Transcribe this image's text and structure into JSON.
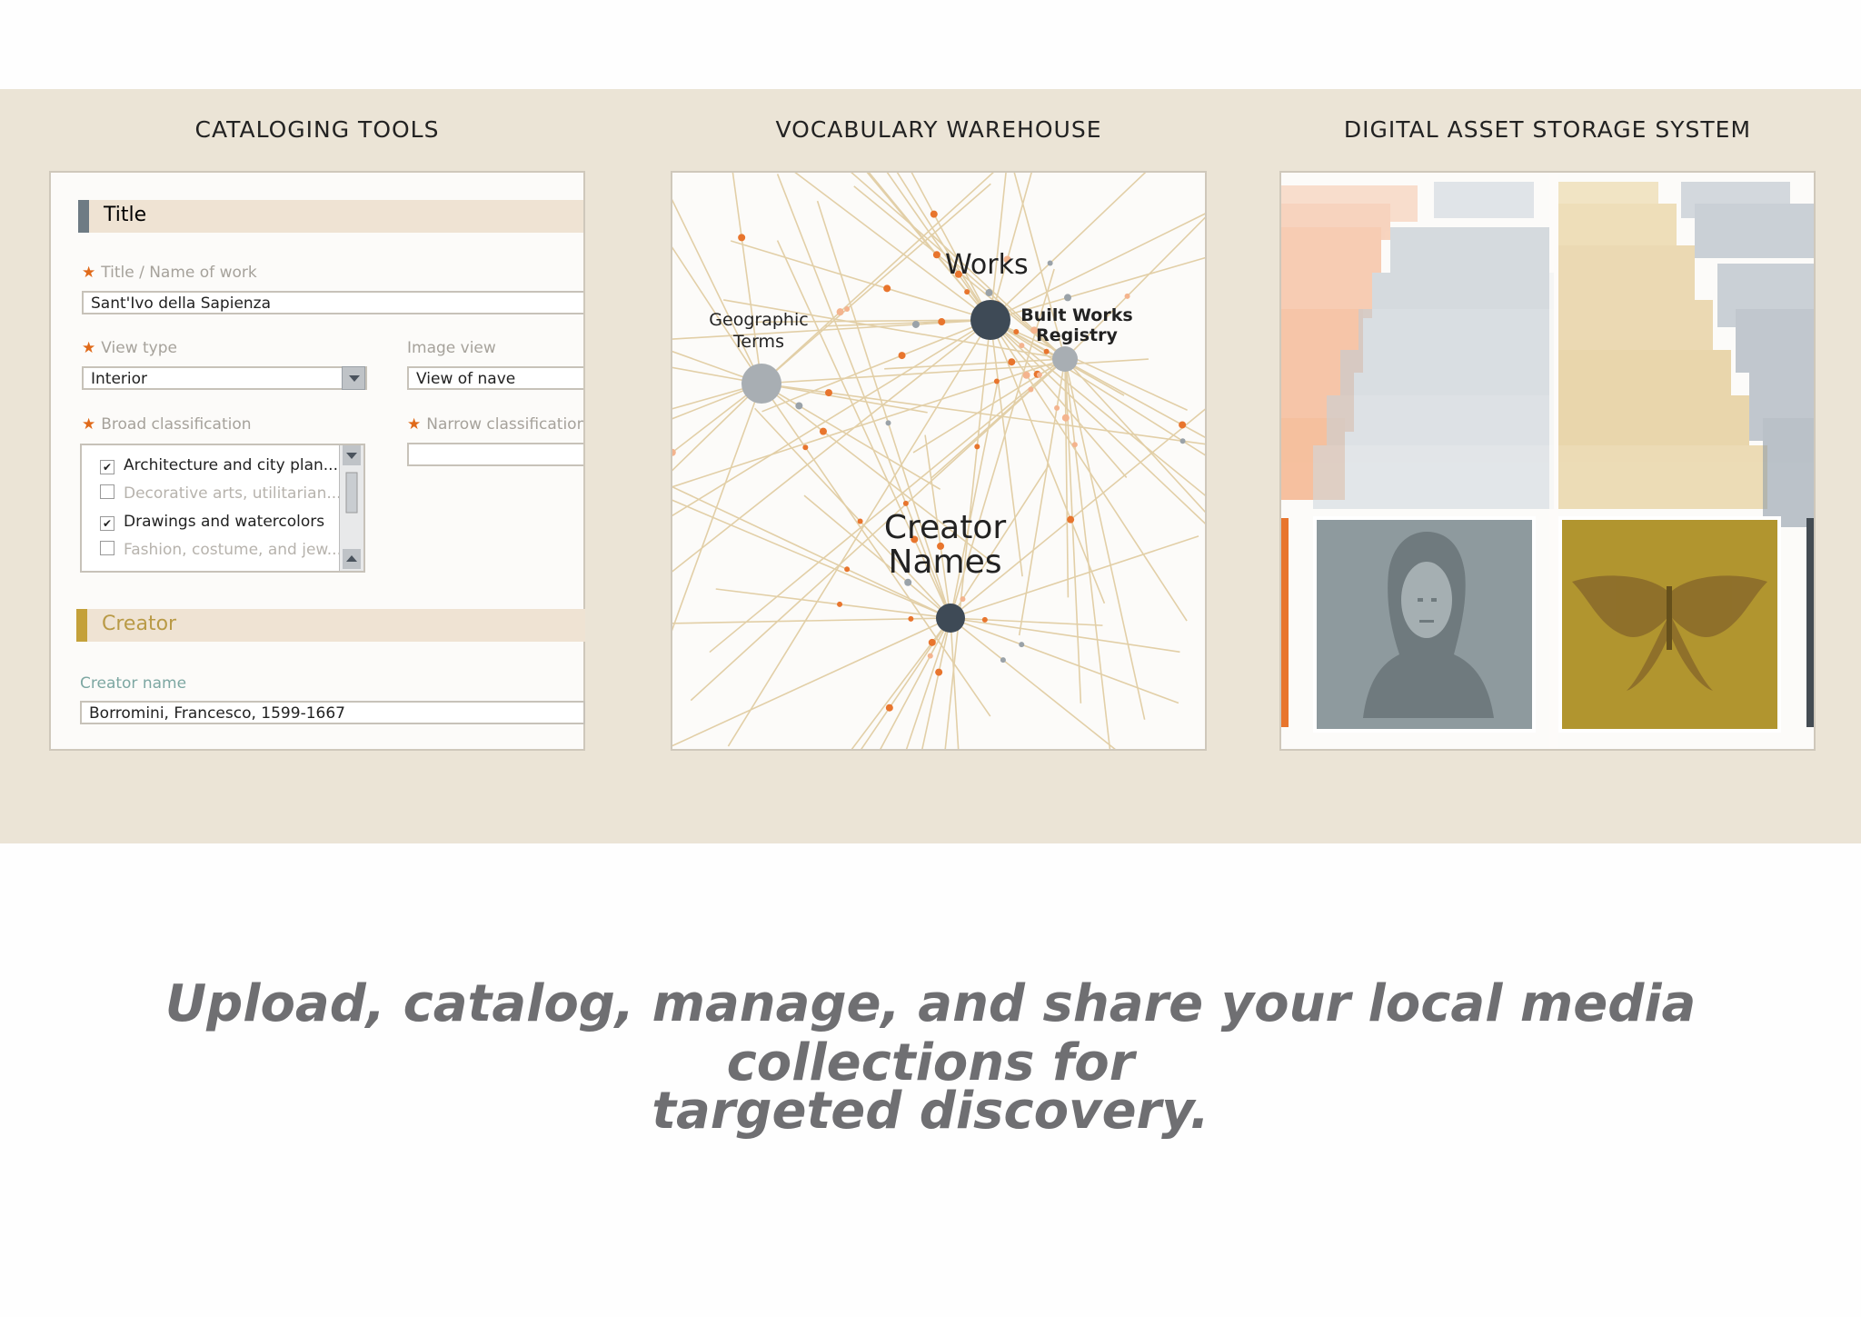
{
  "panels": {
    "cataloging": {
      "heading": "CATALOGING TOOLS",
      "title_section": "Title",
      "title_label": "Title / Name of work",
      "title_value": "Sant'Ivo della Sapienza",
      "view_type_label": "View type",
      "view_type_value": "Interior",
      "image_view_label": "Image view",
      "image_view_value": "View of nave",
      "broad_label": "Broad classification",
      "narrow_label": "Narrow classification",
      "list_items": [
        {
          "label": "Architecture and city plan...",
          "checked": true
        },
        {
          "label": "Decorative arts, utilitarian...",
          "checked": false
        },
        {
          "label": "Drawings and watercolors",
          "checked": true
        },
        {
          "label": "Fashion, costume, and jew...",
          "checked": false
        }
      ],
      "creator_section": "Creator",
      "creator_label": "Creator name",
      "creator_value": "Borromini, Francesco, 1599-1667"
    },
    "vocabulary": {
      "heading": "VOCABULARY WAREHOUSE",
      "nodes": {
        "works": "Works",
        "geo_line1": "Geographic",
        "geo_line2": "Terms",
        "built_line1": "Built Works",
        "built_line2": "Registry",
        "creator_line1": "Creator",
        "creator_line2": "Names"
      }
    },
    "storage": {
      "heading": "DIGITAL ASSET STORAGE SYSTEM"
    }
  },
  "caption": {
    "line1": "Upload, catalog, manage, and share your local media collections for",
    "line2": "targeted discovery."
  },
  "colors": {
    "band": "#ebe4d6",
    "orange": "#f4a77a",
    "slate": "#a9b4bf",
    "gold": "#e2c88e",
    "accent_orange": "#e06a1a",
    "creator_bar": "#c4a13a",
    "title_bar": "#6e7b84"
  }
}
